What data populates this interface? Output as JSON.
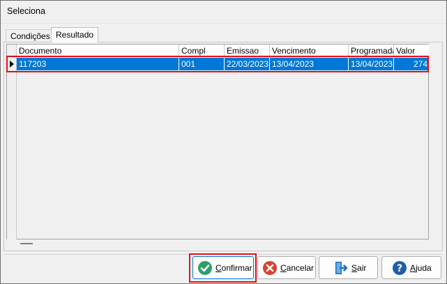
{
  "window": {
    "title": "Seleciona"
  },
  "tabs": [
    {
      "label": "Condições"
    },
    {
      "label": "Resultado"
    }
  ],
  "grid": {
    "columns": [
      "Documento",
      "Compl",
      "Emissao",
      "Vencimento",
      "Programada",
      "Valor"
    ],
    "rows": [
      [
        "117203",
        "001",
        "22/03/2023",
        "13/04/2023",
        "13/04/2023",
        "274"
      ]
    ]
  },
  "buttons": {
    "confirm": "Confirmar",
    "cancel": "Cancelar",
    "exit": "Sair",
    "help": "Ajuda"
  },
  "colors": {
    "selection": "#0078d7",
    "annotation": "#e0101c",
    "confirm_icon": "#2e9e6b",
    "cancel_icon": "#d9432f",
    "exit_icon": "#1e6fb8",
    "help_icon": "#1f5fa8"
  }
}
